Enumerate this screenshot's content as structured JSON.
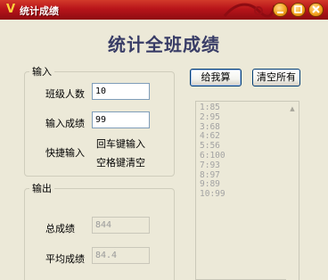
{
  "window": {
    "title": "统计成绩",
    "icon": "v-logo-icon"
  },
  "heading": "统计全班成绩",
  "input_group": {
    "label": "输入",
    "class_count_label": "班级人数",
    "class_count_value": "10",
    "score_label": "输入成绩",
    "score_value": "99",
    "shortcut_label": "快捷输入",
    "shortcut_enter": "回车键输入",
    "shortcut_space": "空格键清空"
  },
  "output_group": {
    "label": "输出",
    "total_label": "总成绩",
    "total_value": "844",
    "average_label": "平均成绩",
    "average_value": "84.4"
  },
  "buttons": {
    "calc": "给我算",
    "clear_all": "清空所有"
  },
  "score_list": [
    "1:85",
    "2:95",
    "3:68",
    "4:62",
    "5:56",
    "6:100",
    "7:93",
    "8:97",
    "9:89",
    "10:99"
  ],
  "colors": {
    "titlebar": "#b8141a",
    "heading": "#383c66",
    "window_bg": "#ece9d8"
  }
}
